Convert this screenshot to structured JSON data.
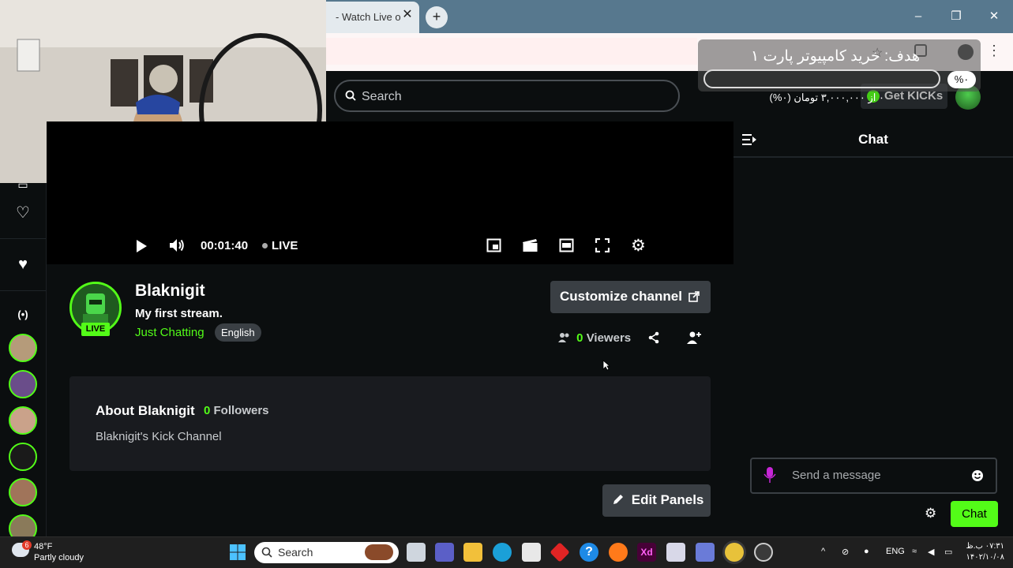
{
  "browser": {
    "tab_title": "- Watch Live o",
    "new_tab": "+",
    "close_tab": "✕",
    "window_controls": [
      "–",
      "❐",
      "✕"
    ]
  },
  "header": {
    "search_placeholder": "Search",
    "kicks_label": "Get KICKs"
  },
  "overlay_goal": {
    "title": "هدف: خرید کامپیوتر پارت ۱",
    "amount": "۰ از ۳,۰۰۰,۰۰۰ تومان (۰%)",
    "percent": "%۰",
    "progress": 0
  },
  "player": {
    "time": "00:01:40",
    "live_label": "LIVE"
  },
  "channel": {
    "name": "Blaknigit",
    "title": "My first stream.",
    "category": "Just Chatting",
    "language": "English",
    "live_badge": "LIVE",
    "customize_label": "Customize channel",
    "viewers_count": "0",
    "viewers_label": "Viewers"
  },
  "about": {
    "title": "About Blaknigit",
    "followers_count": "0",
    "followers_label": "Followers",
    "description": "Blaknigit's Kick Channel"
  },
  "edit_panels_label": "Edit Panels",
  "chat": {
    "title": "Chat",
    "placeholder": "Send a message",
    "send_label": "Chat"
  },
  "taskbar": {
    "temperature": "48°F",
    "weather": "Partly cloudy",
    "weather_badge": "6",
    "search_label": "Search",
    "language": "ENG",
    "time": "۰۷:۳۱ ب.ظ",
    "date": "۱۴۰۲/۱۰/۰۸"
  },
  "colors": {
    "accent": "#53fc18",
    "background": "#0b0e0f",
    "panel": "#191b1f",
    "button": "#3a3f44"
  }
}
